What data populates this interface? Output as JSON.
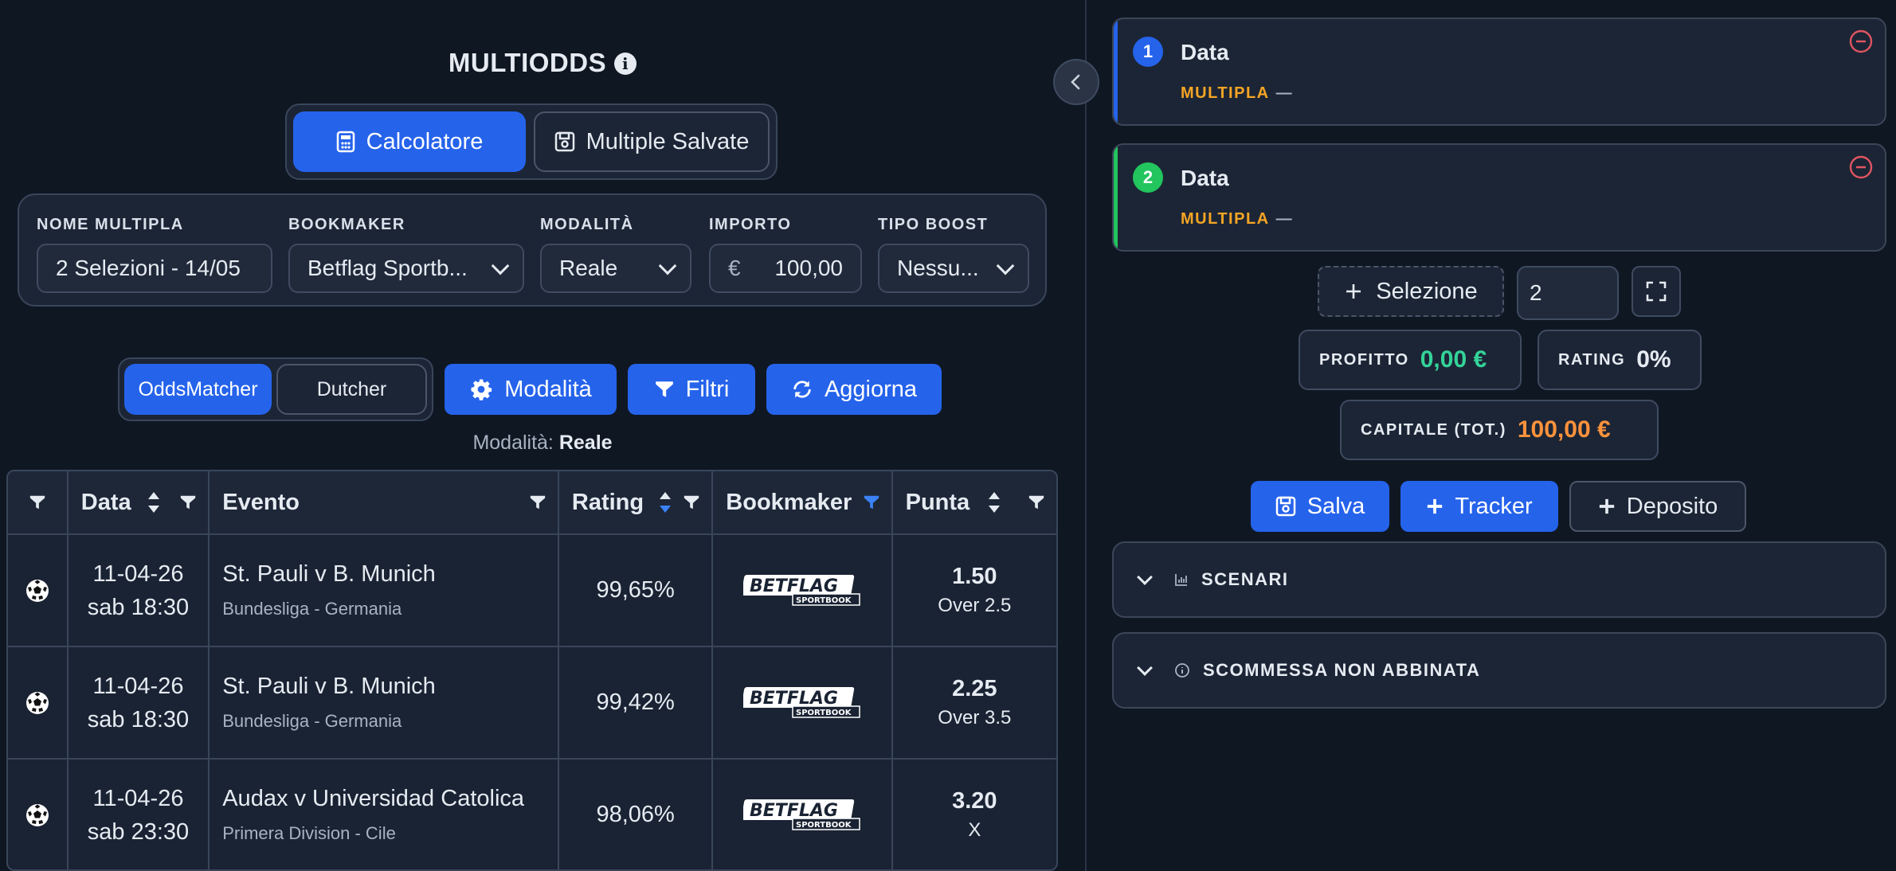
{
  "header": {
    "title": "MULTIODDS"
  },
  "tabs": [
    {
      "label": "Calcolatore"
    },
    {
      "label": "Multiple Salvate"
    }
  ],
  "form": {
    "nome_label": "NOME MULTIPLA",
    "nome_value": "2 Selezioni - 14/05",
    "bookmaker_label": "BOOKMAKER",
    "bookmaker_value": "Betflag Sportb...",
    "modalita_label": "MODALITÀ",
    "modalita_value": "Reale",
    "importo_label": "IMPORTO",
    "importo_currency": "€",
    "importo_value": "100,00",
    "boost_label": "TIPO BOOST",
    "boost_value": "Nessu..."
  },
  "controls": {
    "seg_on": "OddsMatcher",
    "seg_off": "Dutcher",
    "modalita_btn": "Modalità",
    "filtri_btn": "Filtri",
    "aggiorna_btn": "Aggiorna",
    "mod_prefix": "Modalità:",
    "mod_value": "Reale"
  },
  "table": {
    "headers": {
      "data": "Data",
      "evento": "Evento",
      "rating": "Rating",
      "bookmaker": "Bookmaker",
      "punta": "Punta"
    },
    "rows": [
      {
        "date": "11-04-26",
        "time": "sab 18:30",
        "event": "St. Pauli v B. Munich",
        "league": "Bundesliga - Germania",
        "rating": "99,65%",
        "odd": "1.50",
        "market": "Over 2.5"
      },
      {
        "date": "11-04-26",
        "time": "sab 18:30",
        "event": "St. Pauli v B. Munich",
        "league": "Bundesliga - Germania",
        "rating": "99,42%",
        "odd": "2.25",
        "market": "Over 3.5"
      },
      {
        "date": "11-04-26",
        "time": "sab 23:30",
        "event": "Audax v Universidad Catolica",
        "league": "Primera Division - Cile",
        "rating": "98,06%",
        "odd": "3.20",
        "market": "X"
      }
    ],
    "logo_text": {
      "main": "BETFLAG",
      "sub": "SPORTBOOK"
    }
  },
  "selections": [
    {
      "num": "1",
      "title": "Data",
      "label": "MULTIPLA",
      "value": "—",
      "color": "#2563eb"
    },
    {
      "num": "2",
      "title": "Data",
      "label": "MULTIPLA",
      "value": "—",
      "color": "#22c55e"
    }
  ],
  "sel_controls": {
    "add_label": "Selezione",
    "count": "2"
  },
  "stats": {
    "profitto_label": "PROFITTO",
    "profitto_value": "0,00 €",
    "rating_label": "RATING",
    "rating_value": "0%",
    "capitale_label": "CAPITALE (TOT.)",
    "capitale_value": "100,00 €"
  },
  "actions": {
    "salva": "Salva",
    "tracker": "Tracker",
    "deposito": "Deposito"
  },
  "accordions": {
    "scenari": "SCENARI",
    "non_abbinata": "SCOMMESSA NON ABBINATA"
  },
  "colors": {
    "accent": "#2563eb",
    "green": "#34d399",
    "orange": "#fb923c",
    "amber": "#f5a524"
  }
}
